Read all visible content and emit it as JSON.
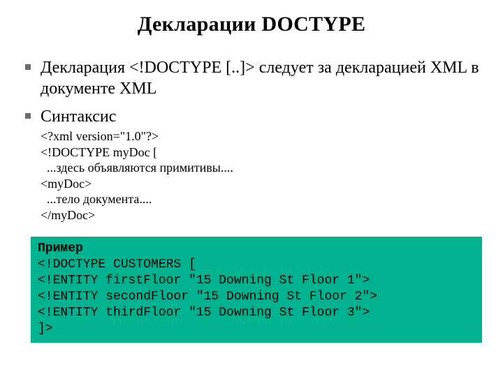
{
  "title": "Декларации DOCTYPE",
  "bullets": {
    "b1": "Декларация <!DOCTYPE [..]> следует за декларацией XML в документе XML",
    "b2": "Синтаксис"
  },
  "syntax": {
    "l1": "<?xml version=\"1.0\"?>",
    "l2": "<!DOCTYPE myDoc [",
    "l3": "  ...здесь объявляются примитивы....",
    "l4": "<myDoc>",
    "l5": "  ...тело документа....",
    "l6": "</myDoc>"
  },
  "example": {
    "label": "Пример",
    "l1": "<!DOCTYPE CUSTOMERS [",
    "l2": "<!ENTITY firstFloor \"15 Downing St Floor 1\">",
    "l3": "<!ENTITY secondFloor \"15 Downing St Floor 2\">",
    "l4": "<!ENTITY thirdFloor \"15 Downing St Floor 3\">",
    "l5": "]>"
  }
}
